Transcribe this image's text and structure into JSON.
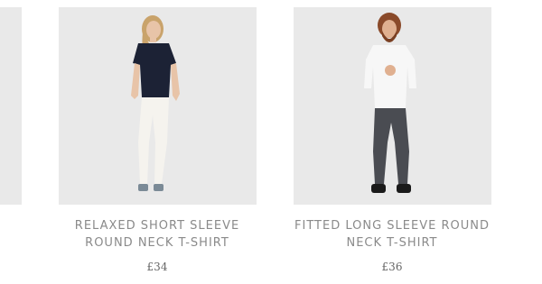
{
  "products": [
    {
      "title": "RELAXED SHORT SLEEVE\nROUND NECK T-SHIRT",
      "price": "£34",
      "image": "model-woman-navy-tshirt"
    },
    {
      "title": "FITTED LONG SLEEVE ROUND\nNECK T-SHIRT",
      "price": "£36",
      "image": "model-man-white-longsleeve"
    }
  ],
  "colors": {
    "image_bg": "#e9e9e9",
    "title": "#8a8a8a",
    "price": "#666666"
  }
}
